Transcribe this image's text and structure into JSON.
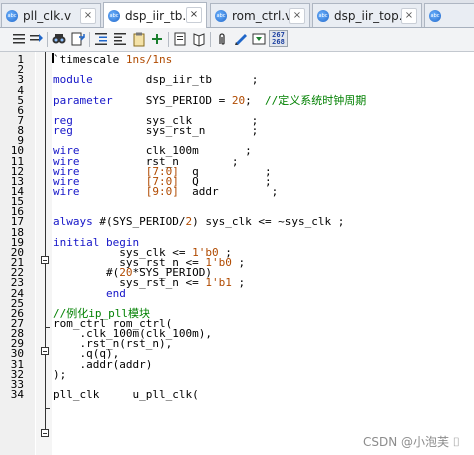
{
  "tabs": [
    {
      "label": "pll_clk.v",
      "active": false,
      "close": "×"
    },
    {
      "label": "dsp_iir_tb.v",
      "active": true,
      "close": "×"
    },
    {
      "label": "rom_ctrl.v",
      "active": false,
      "close": "×"
    },
    {
      "label": "dsp_iir_top.v",
      "active": false,
      "close": "×"
    },
    {
      "label": "",
      "active": false,
      "close": ""
    }
  ],
  "file_icon_text": "abc",
  "toolbar": {
    "icons": [
      "insert-lines-icon",
      "shift-right-icon",
      "find-icon",
      "find-in-files-icon",
      "indent-icon",
      "outdent-icon",
      "clipboard-icon",
      "toggle-case-icon",
      "bookmark-toggle-icon",
      "book-icon",
      "next-bookmark-icon",
      "attach-icon",
      "attach-2-icon",
      "wrap-icon",
      "clear-icon"
    ],
    "line_col_top": "267",
    "line_col_bottom": "268"
  },
  "editor": {
    "lines": [
      {
        "n": "1",
        "tokens": [
          {
            "t": "`timescale ",
            "c": ""
          },
          {
            "t": "1ns/1ns",
            "c": "num"
          }
        ]
      },
      {
        "n": "2",
        "tokens": []
      },
      {
        "n": "3",
        "tokens": [
          {
            "t": "module",
            "c": "kw"
          },
          {
            "t": "        dsp_iir_tb      ;",
            "c": ""
          }
        ]
      },
      {
        "n": "4",
        "tokens": []
      },
      {
        "n": "5",
        "tokens": [
          {
            "t": "parameter",
            "c": "kw"
          },
          {
            "t": "     SYS_PERIOD = ",
            "c": ""
          },
          {
            "t": "20",
            "c": "num"
          },
          {
            "t": ";  ",
            "c": ""
          },
          {
            "t": "//定义系统时钟周期",
            "c": "com"
          }
        ]
      },
      {
        "n": "6",
        "tokens": []
      },
      {
        "n": "7",
        "tokens": [
          {
            "t": "reg",
            "c": "kw"
          },
          {
            "t": "           sys_clk         ;",
            "c": ""
          }
        ]
      },
      {
        "n": "8",
        "tokens": [
          {
            "t": "reg",
            "c": "kw"
          },
          {
            "t": "           sys_rst_n       ;",
            "c": ""
          }
        ]
      },
      {
        "n": "9",
        "tokens": []
      },
      {
        "n": "10",
        "tokens": [
          {
            "t": "wire",
            "c": "kw"
          },
          {
            "t": "          clk_100m       ;",
            "c": ""
          }
        ]
      },
      {
        "n": "11",
        "tokens": [
          {
            "t": "wire",
            "c": "kw"
          },
          {
            "t": "          rst_n        ;",
            "c": ""
          }
        ]
      },
      {
        "n": "12",
        "tokens": [
          {
            "t": "wire",
            "c": "kw"
          },
          {
            "t": "          ",
            "c": ""
          },
          {
            "t": "[7:0]",
            "c": "brk"
          },
          {
            "t": "  q          ;",
            "c": ""
          }
        ]
      },
      {
        "n": "13",
        "tokens": [
          {
            "t": "wire",
            "c": "kw"
          },
          {
            "t": "          ",
            "c": ""
          },
          {
            "t": "[7:0]",
            "c": "brk"
          },
          {
            "t": "  Q          ;",
            "c": ""
          }
        ]
      },
      {
        "n": "14",
        "tokens": [
          {
            "t": "wire",
            "c": "kw"
          },
          {
            "t": "          ",
            "c": ""
          },
          {
            "t": "[9:0]",
            "c": "brk"
          },
          {
            "t": "  addr        ;",
            "c": ""
          }
        ]
      },
      {
        "n": "15",
        "tokens": []
      },
      {
        "n": "16",
        "tokens": []
      },
      {
        "n": "17",
        "tokens": [
          {
            "t": "always",
            "c": "kw"
          },
          {
            "t": " #(SYS_PERIOD/",
            "c": ""
          },
          {
            "t": "2",
            "c": "num"
          },
          {
            "t": ") sys_clk <= ~sys_clk ;",
            "c": ""
          }
        ]
      },
      {
        "n": "18",
        "tokens": []
      },
      {
        "n": "19",
        "tokens": [
          {
            "t": "initial",
            "c": "kw"
          },
          {
            "t": " ",
            "c": ""
          },
          {
            "t": "begin",
            "c": "kw"
          }
        ]
      },
      {
        "n": "20",
        "tokens": [
          {
            "t": "          sys_clk <= ",
            "c": ""
          },
          {
            "t": "1'b0",
            "c": "num"
          },
          {
            "t": " ;",
            "c": ""
          }
        ]
      },
      {
        "n": "21",
        "tokens": [
          {
            "t": "          sys_rst_n <= ",
            "c": ""
          },
          {
            "t": "1'b0",
            "c": "num"
          },
          {
            "t": " ;",
            "c": ""
          }
        ]
      },
      {
        "n": "22",
        "tokens": [
          {
            "t": "        #(",
            "c": ""
          },
          {
            "t": "20",
            "c": "num"
          },
          {
            "t": "*SYS_PERIOD)",
            "c": ""
          }
        ]
      },
      {
        "n": "23",
        "tokens": [
          {
            "t": "          sys_rst_n <= ",
            "c": ""
          },
          {
            "t": "1'b1",
            "c": "num"
          },
          {
            "t": " ;",
            "c": ""
          }
        ]
      },
      {
        "n": "24",
        "tokens": [
          {
            "t": "        ",
            "c": ""
          },
          {
            "t": "end",
            "c": "kw"
          }
        ]
      },
      {
        "n": "25",
        "tokens": []
      },
      {
        "n": "26",
        "tokens": [
          {
            "t": "//例化ip_pll模块",
            "c": "com"
          }
        ]
      },
      {
        "n": "27",
        "tokens": [
          {
            "t": "rom_ctrl rom_ctrl(",
            "c": ""
          }
        ]
      },
      {
        "n": "28",
        "tokens": [
          {
            "t": "    .clk_100m(clk_100m),",
            "c": ""
          }
        ]
      },
      {
        "n": "29",
        "tokens": [
          {
            "t": "    .rst_n(rst_n),",
            "c": ""
          }
        ]
      },
      {
        "n": "30",
        "tokens": [
          {
            "t": "    .q(q),",
            "c": ""
          }
        ]
      },
      {
        "n": "31",
        "tokens": [
          {
            "t": "    .addr(addr)",
            "c": ""
          }
        ]
      },
      {
        "n": "32",
        "tokens": [
          {
            "t": ");",
            "c": ""
          }
        ]
      },
      {
        "n": "33",
        "tokens": []
      },
      {
        "n": "34",
        "tokens": [
          {
            "t": "pll_clk     u_pll_clk(",
            "c": ""
          }
        ]
      }
    ]
  },
  "watermark": "CSDN @小泡芙 ⌷"
}
